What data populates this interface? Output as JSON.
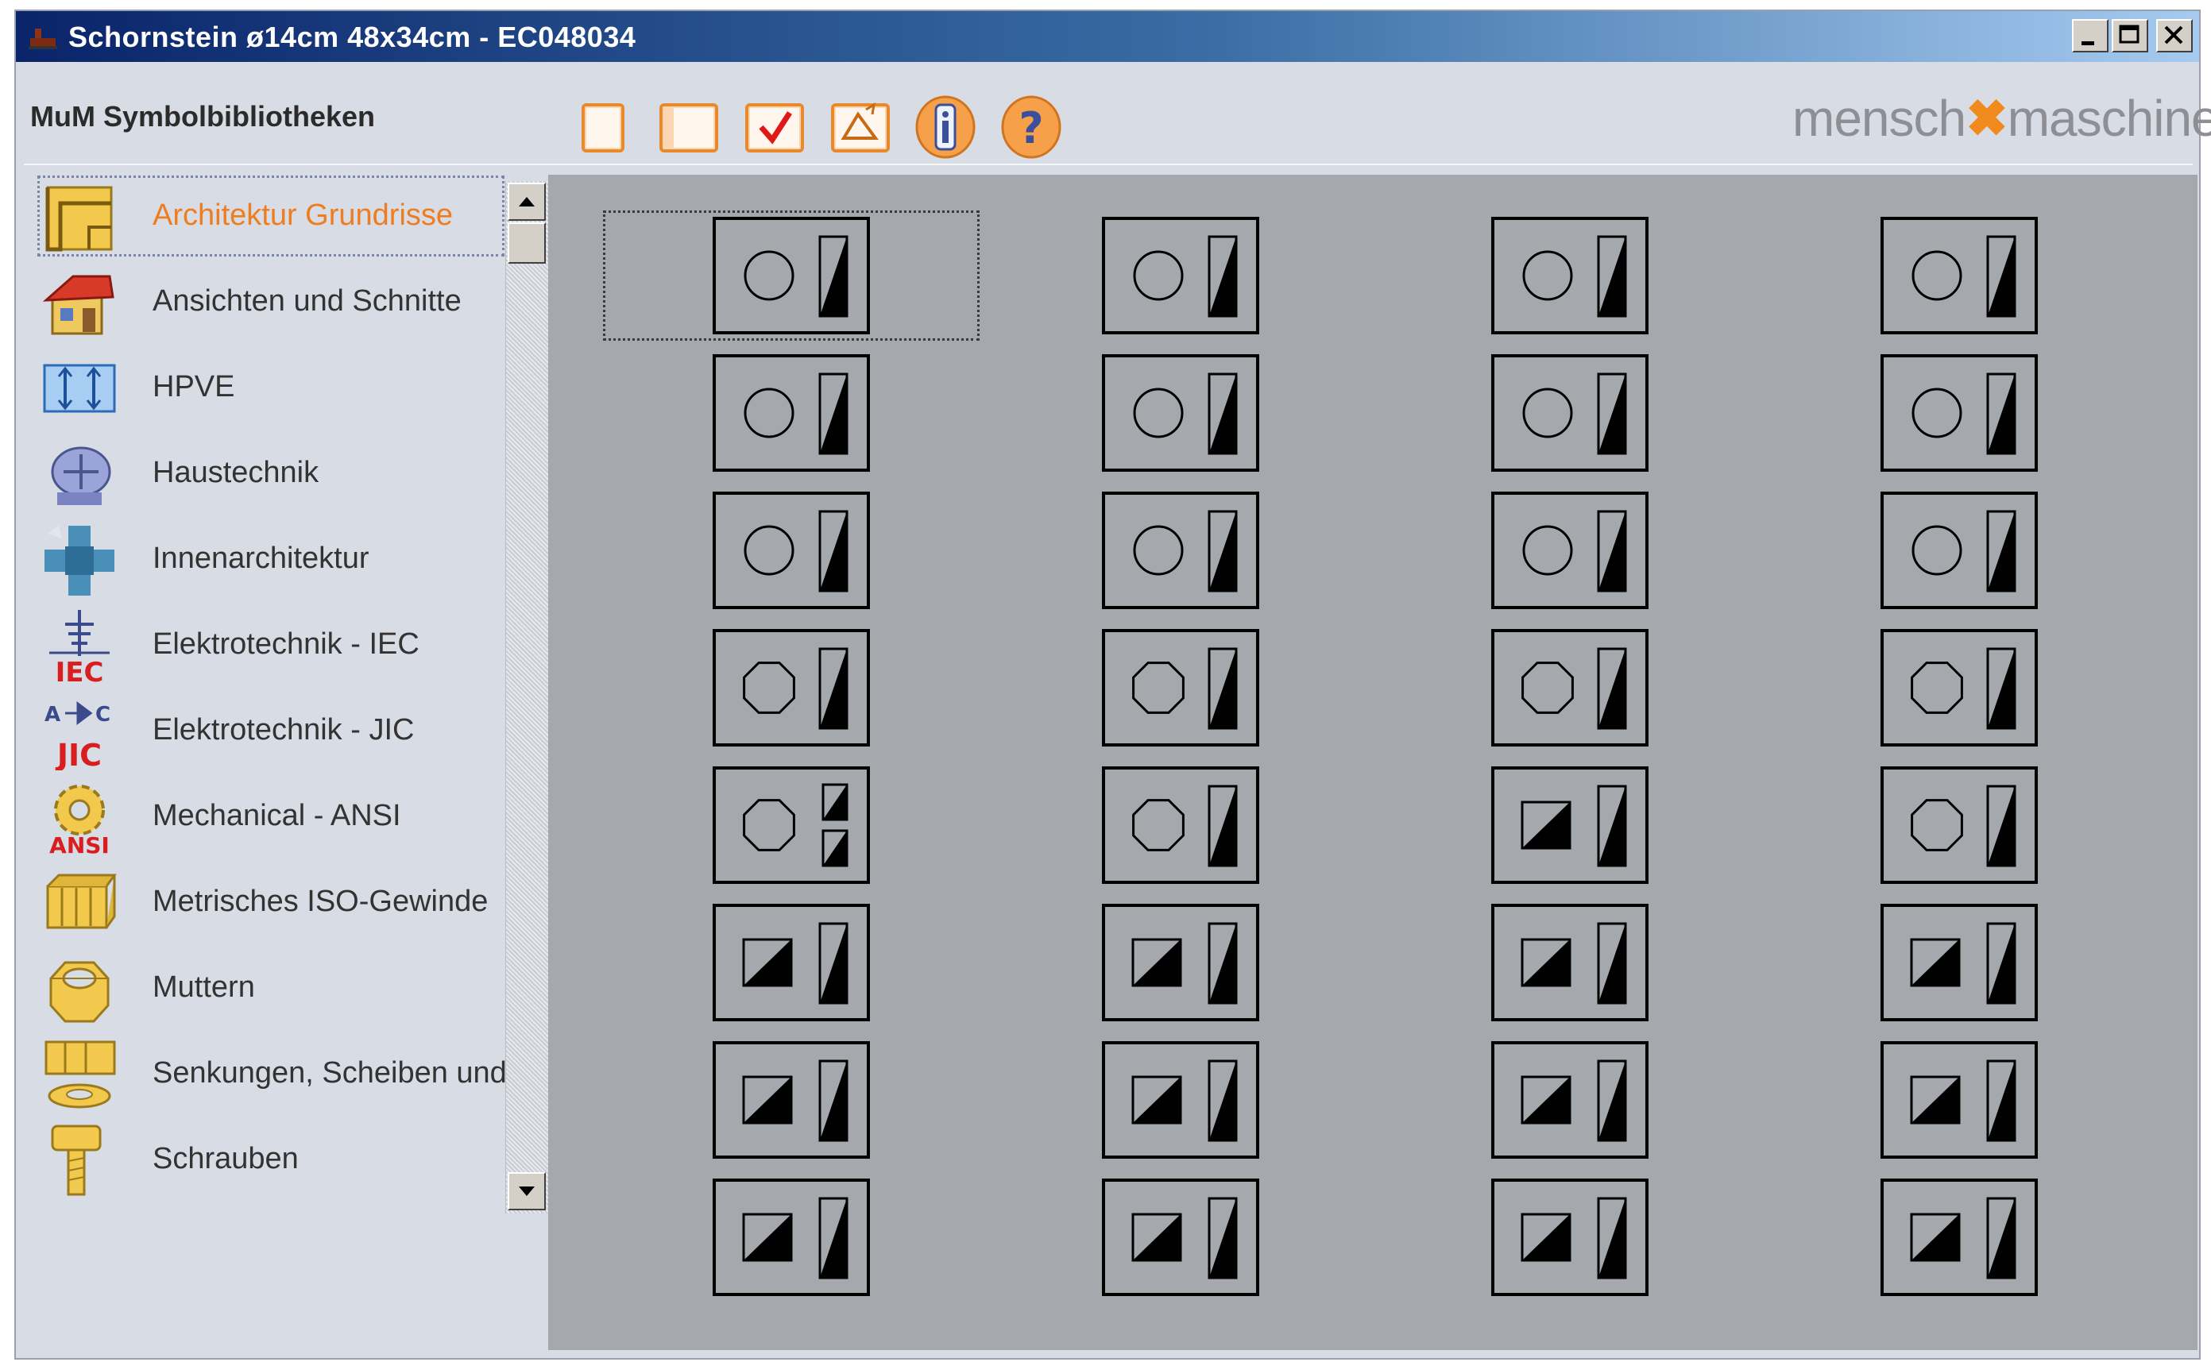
{
  "window": {
    "title": "Schornstein ø14cm 48x34cm - EC048034",
    "controls": [
      "minimize-icon",
      "maximize-icon",
      "close-icon"
    ]
  },
  "toolbar": {
    "label": "MuM Symbolbibliotheken",
    "buttons": [
      {
        "name": "new-window-button",
        "icon": "blank-page-icon"
      },
      {
        "name": "split-view-button",
        "icon": "panel-icon"
      },
      {
        "name": "check-button",
        "icon": "checkmark-icon"
      },
      {
        "name": "insert-button",
        "icon": "insert-icon"
      },
      {
        "name": "info-button",
        "icon": "info-icon"
      },
      {
        "name": "help-button",
        "icon": "help-icon"
      }
    ],
    "accent": "#f6a14a"
  },
  "logo": {
    "left": "mensch",
    "mid": "✖",
    "right": "maschine"
  },
  "sidebar": {
    "selected_color": "#ef7d1f",
    "items": [
      {
        "label": "Architektur Grundrisse",
        "icon": "floorplan-icon",
        "selected": true
      },
      {
        "label": "Ansichten und Schnitte",
        "icon": "house-icon"
      },
      {
        "label": "HPVE",
        "icon": "hpve-icon"
      },
      {
        "label": "Haustechnik",
        "icon": "building-services-icon"
      },
      {
        "label": "Innenarchitektur",
        "icon": "interior-icon"
      },
      {
        "label": "Elektrotechnik - IEC",
        "icon": "iec-icon",
        "badge": "IEC"
      },
      {
        "label": "Elektrotechnik - JIC",
        "icon": "jic-icon",
        "badge": "JIC"
      },
      {
        "label": "Mechanical - ANSI",
        "icon": "ansi-gear-icon",
        "badge": "ANSI"
      },
      {
        "label": "Metrisches ISO-Gewinde",
        "icon": "thread-icon"
      },
      {
        "label": "Muttern",
        "icon": "nut-icon"
      },
      {
        "label": "Senkungen, Scheiben und Du",
        "icon": "washer-icon"
      },
      {
        "label": "Schrauben",
        "icon": "screw-icon"
      }
    ]
  },
  "symbols": {
    "rows": 8,
    "cols": 4,
    "selected_index": 0,
    "items": [
      "round",
      "round",
      "round",
      "round",
      "round",
      "round",
      "round",
      "round",
      "round",
      "round",
      "round",
      "round",
      "octagon",
      "octagon",
      "octagon",
      "octagon",
      "octagon-double",
      "octagon",
      "square-diag",
      "octagon",
      "square-diag",
      "square-diag",
      "square-diag",
      "square-diag",
      "square-diag",
      "square-diag",
      "square-diag",
      "square-diag",
      "square-diag",
      "square-diag",
      "square-diag",
      "square-diag"
    ]
  }
}
